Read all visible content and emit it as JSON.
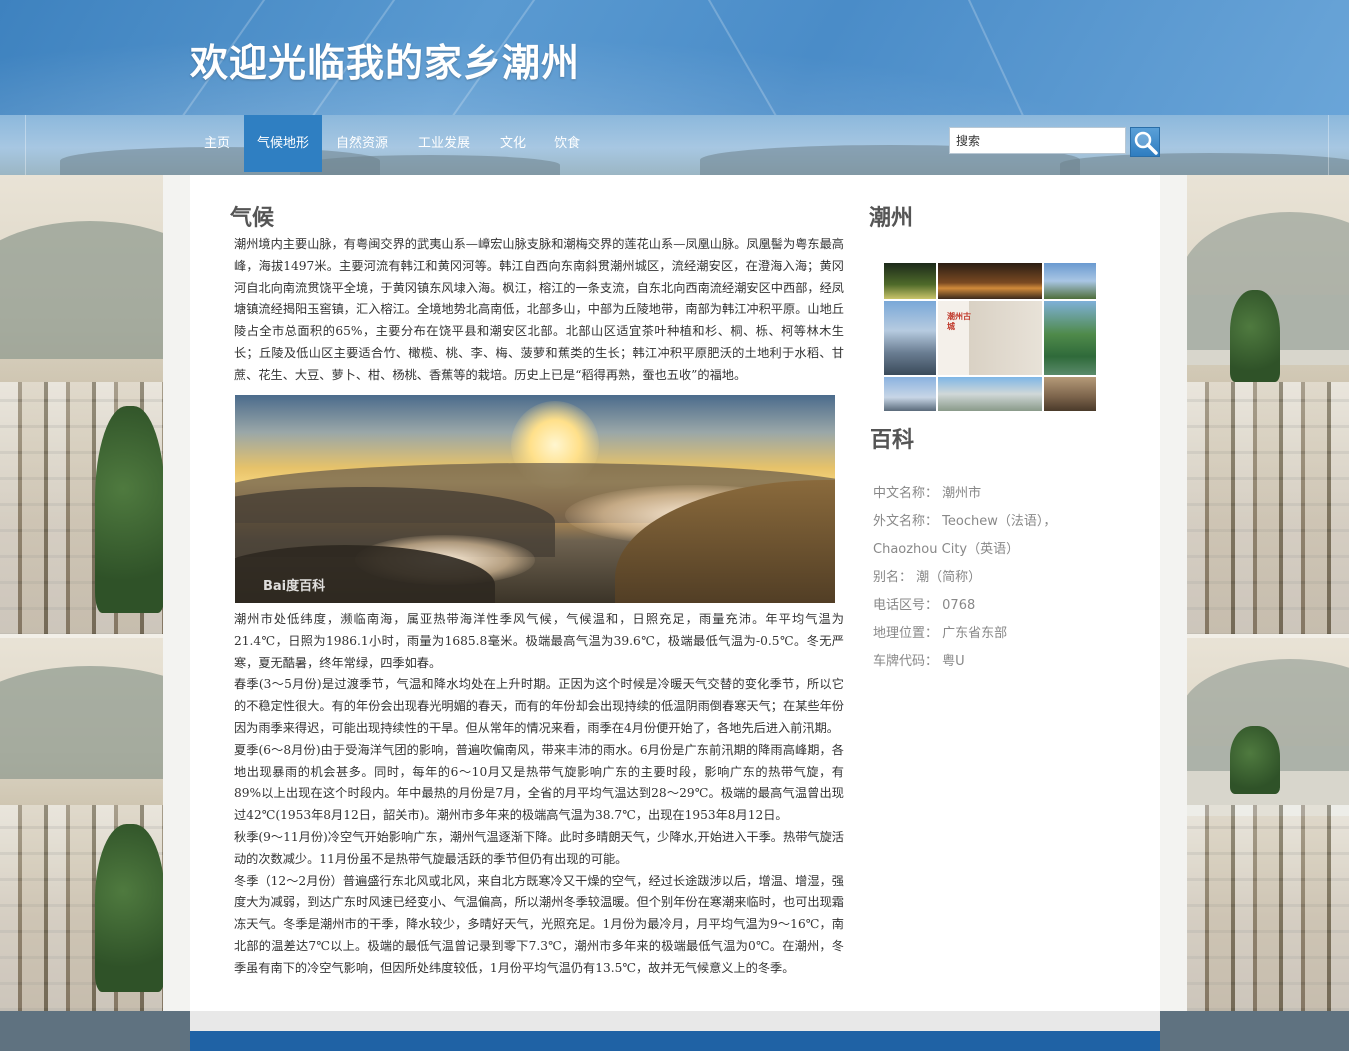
{
  "site": {
    "title": "欢迎光临我的家乡潮州"
  },
  "nav": {
    "items": [
      {
        "label": "主页"
      },
      {
        "label": "气候地形"
      },
      {
        "label": "自然资源"
      },
      {
        "label": "工业发展"
      },
      {
        "label": "文化"
      },
      {
        "label": "饮食"
      }
    ],
    "active_index": 1
  },
  "search": {
    "value": "搜索"
  },
  "main": {
    "heading": "气候",
    "intro": "潮州境内主要山脉，有粤闽交界的武夷山系—嶂宏山脉支脉和潮梅交界的莲花山系—凤凰山脉。凤凰髻为粤东最高峰，海拔1497米。主要河流有韩江和黄冈河等。韩江自西向东南斜贯潮州城区，流经潮安区，在澄海入海；黄冈河自北向南流贯饶平全境，于黄冈镇东风埭入海。枫江，榕江的一条支流，自东北向西南流经潮安区中西部，经凤塘镇流经揭阳玉窖镇，汇入榕江。全境地势北高南低，北部多山，中部为丘陵地带，南部为韩江冲积平原。山地丘陵占全市总面积的65%，主要分布在饶平县和潮安区北部。北部山区适宜茶叶种植和杉、桐、栎、柯等林木生长；丘陵及低山区主要适合竹、橄榄、桃、李、梅、菠萝和蕉类的生长；韩江冲积平原肥沃的土地利于水稻、甘蔗、花生、大豆、萝卜、柑、杨桃、香蕉等的栽培。历史上已是“稻得再熟，蚕也五收”的福地。",
    "photo_watermark": "Bai度百科",
    "climate": "潮州市处低纬度，濒临南海，属亚热带海洋性季风气候，气候温和，日照充足，雨量充沛。年平均气温为21.4℃，日照为1986.1小时，雨量为1685.8毫米。极端最高气温为39.6℃，极端最低气温为-0.5℃。冬无严寒，夏无酷暑，终年常绿，四季如春。",
    "spring": "春季(3～5月份)是过渡季节，气温和降水均处在上升时期。正因为这个时候是冷暖天气交替的变化季节，所以它的不稳定性很大。有的年份会出现春光明媚的春天，而有的年份却会出现持续的低温阴雨倒春寒天气；在某些年份因为雨季来得迟，可能出现持续性的干旱。但从常年的情况来看，雨季在4月份便开始了，各地先后进入前汛期。",
    "summer": "夏季(6～8月份)由于受海洋气团的影响，普遍吹偏南风，带来丰沛的雨水。6月份是广东前汛期的降雨高峰期，各地出现暴雨的机会甚多。同时，每年的6～10月又是热带气旋影响广东的主要时段，影响广东的热带气旋，有89%以上出现在这个时段内。年中最热的月份是7月，全省的月平均气温达到28～29℃。极端的最高气温曾出现过42℃(1953年8月12日，韶关市)。潮州市多年来的极端高气温为38.7℃，出现在1953年8月12日。",
    "autumn": "秋季(9～11月份)冷空气开始影响广东，潮州气温逐渐下降。此时多晴朗天气，少降水,开始进入干季。热带气旋活动的次数减少。11月份虽不是热带气旋最活跃的季节但仍有出现的可能。",
    "winter": "冬季（12～2月份）普遍盛行东北风或北风，来自北方既寒冷又干燥的空气，经过长途跋涉以后，增温、增湿，强度大为减弱，到达广东时风速已经变小、气温偏高，所以潮州冬季较温暖。但个别年份在寒潮来临时，也可出现霜冻天气。冬季是潮州市的干季，降水较少，多晴好天气，光照充足。1月份为最冷月，月平均气温为9～16℃，南北部的温差达7℃以上。极端的最低气温曾记录到零下7.3℃，潮州市多年来的极端最低气温为0℃。在潮州，冬季虽有南下的冷空气影响，但因所处纬度较低，1月份平均气温仍有13.5℃，故并无气候意义上的冬季。"
  },
  "sidebar": {
    "heading": "潮州",
    "collage_label": "潮州古城",
    "baike_heading": "百科",
    "facts": [
      {
        "label": "中文名称：",
        "value": "潮州市"
      },
      {
        "label": "外文名称：",
        "value": "Teochew（法语），Chaozhou City（英语）"
      },
      {
        "label": "别名：",
        "value": "潮（简称）"
      },
      {
        "label": "电话区号：",
        "value": "0768"
      },
      {
        "label": "地理位置：",
        "value": "广东省东部"
      },
      {
        "label": "车牌代码：",
        "value": "粤U"
      }
    ]
  }
}
